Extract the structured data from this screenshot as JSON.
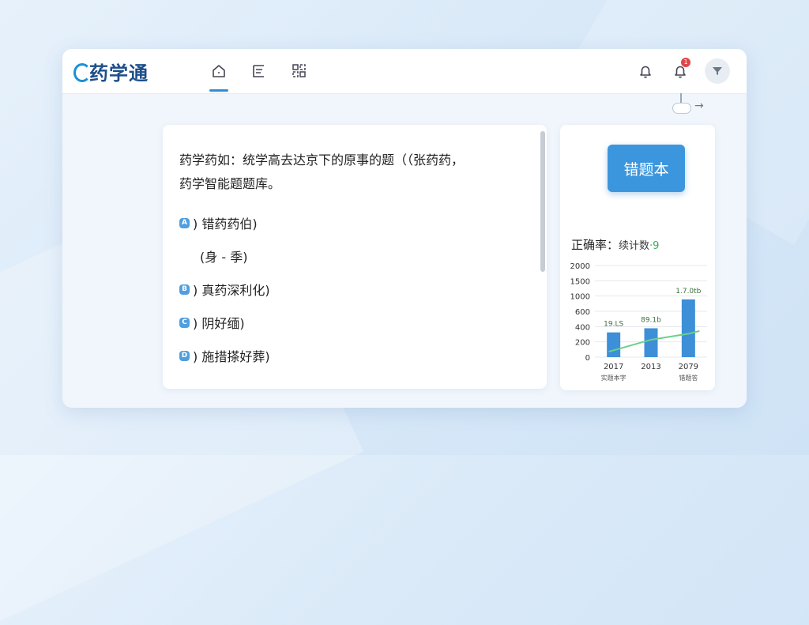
{
  "app": {
    "logo_text": "药学通"
  },
  "nav": {
    "items": [
      {
        "icon": "home-icon",
        "active": true
      },
      {
        "icon": "list-icon",
        "active": false
      },
      {
        "icon": "grid-icon",
        "active": false
      }
    ]
  },
  "header": {
    "notification_badge": "1",
    "icons": [
      "bell-icon",
      "bell-icon",
      "filter-icon"
    ]
  },
  "question": {
    "line1": "药学药如：统学高去达京下的原事的题（（张药药，",
    "line2": "药学智能题题库。",
    "options": [
      {
        "letter": "A",
        "text": ") 错药药伯)"
      },
      {
        "letter": "B",
        "text": ") 真药深利化)"
      },
      {
        "letter": "C",
        "text": ") 阴好缅)"
      },
      {
        "letter": "D",
        "text": ") 施措搽好葬)"
      }
    ],
    "option_a_sub": "(身 - 季)"
  },
  "sidebar": {
    "wrong_book_label": "错题本",
    "rate_label": "正确率：",
    "rate_tail": "续计数",
    "rate_mark": "·9"
  },
  "chart_data": {
    "type": "bar",
    "categories": [
      "2017",
      "2013",
      "2079"
    ],
    "values": [
      540,
      630,
      1260
    ],
    "line_values": [
      120,
      380,
      510
    ],
    "data_labels": [
      "19.LS",
      "89.1b",
      "1.7.0tb"
    ],
    "sub_labels": [
      "实题本字",
      "",
      "错题答"
    ],
    "yticks": [
      2000,
      1500,
      1000,
      600,
      400,
      200,
      0
    ],
    "ylim": [
      0,
      2000
    ],
    "grid": true,
    "bar_color": "#3d8fd8",
    "line_color": "#6bd18a"
  }
}
